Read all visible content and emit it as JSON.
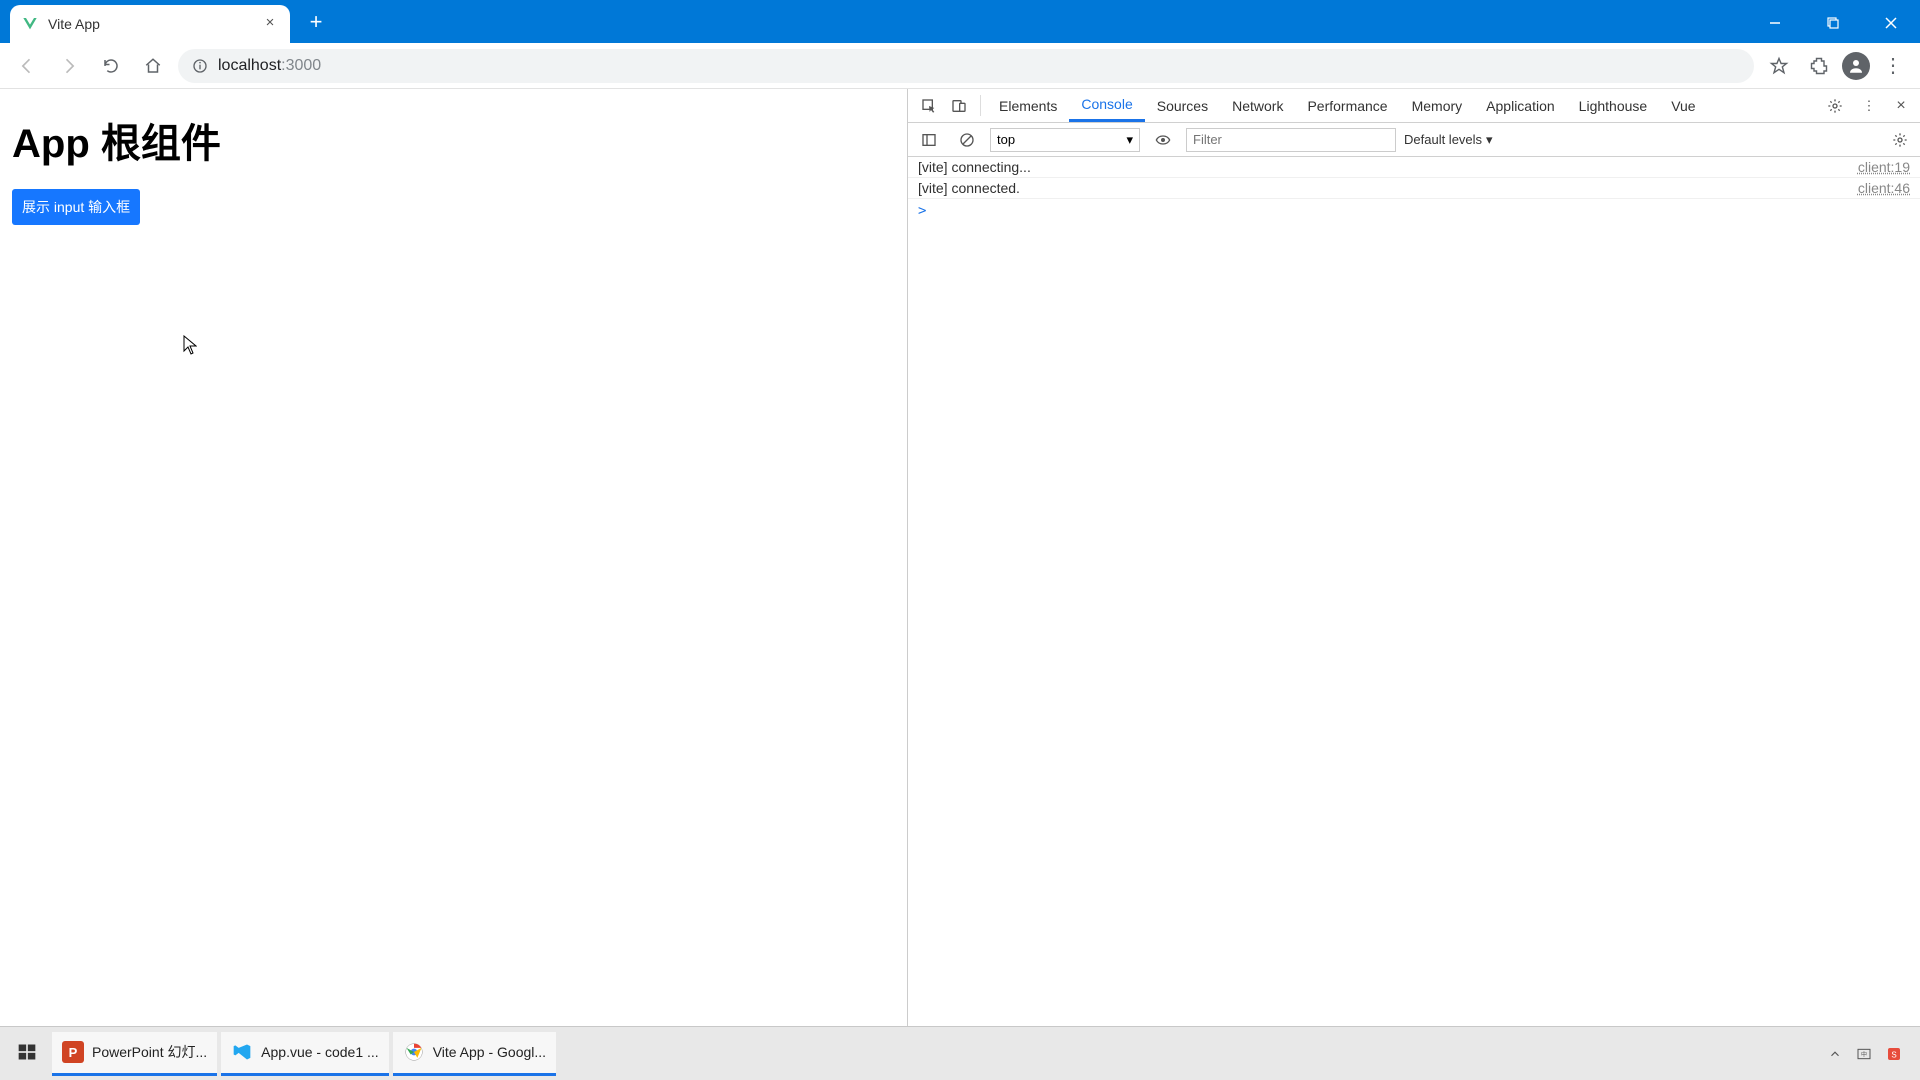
{
  "browser": {
    "tab_title": "Vite App",
    "url_host": "localhost",
    "url_port": ":3000"
  },
  "page": {
    "heading": "App 根组件",
    "button_label": "展示 input 输入框"
  },
  "devtools": {
    "tabs": [
      "Elements",
      "Console",
      "Sources",
      "Network",
      "Performance",
      "Memory",
      "Application",
      "Lighthouse",
      "Vue"
    ],
    "active_tab": "Console",
    "context": "top",
    "filter_placeholder": "Filter",
    "levels_label": "Default levels",
    "lines": [
      {
        "msg": "[vite] connecting...",
        "src": "client:19"
      },
      {
        "msg": "[vite] connected.",
        "src": "client:46"
      }
    ],
    "prompt": ">"
  },
  "taskbar": {
    "items": [
      {
        "label": "PowerPoint 幻灯...",
        "color": "#d04423"
      },
      {
        "label": "App.vue - code1 ...",
        "color": "#22a7f0"
      },
      {
        "label": "Vite App - Googl...",
        "color": "#ffffff"
      }
    ]
  }
}
